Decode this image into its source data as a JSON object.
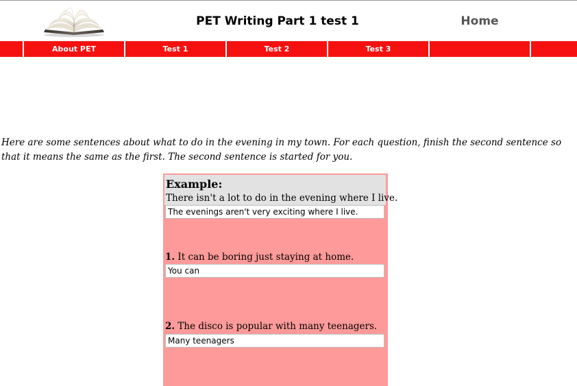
{
  "header": {
    "site_title": "PET Writing Part 1 test 1",
    "home_label": "Home"
  },
  "nav": {
    "items": [
      {
        "label": ""
      },
      {
        "label": "About PET"
      },
      {
        "label": "Test 1"
      },
      {
        "label": "Test 2"
      },
      {
        "label": "Test 3"
      },
      {
        "label": ""
      },
      {
        "label": ""
      }
    ]
  },
  "intro": "Here are some sentences about what to do in the evening in my town. For each question, finish the second sentence so that it means the same as the first. The second sentence is started for you.",
  "example": {
    "heading": "Example:",
    "sentence": "There isn't a lot to do in the evening where I live.",
    "answer": "The evenings aren't very exciting where I live."
  },
  "questions": [
    {
      "number": "1.",
      "text": "It can be boring just staying at home.",
      "answer": "You can"
    },
    {
      "number": "2.",
      "text": "The disco is popular with many teenagers.",
      "answer": "Many teenagers"
    }
  ],
  "colors": {
    "nav_red": "#f61111",
    "panel_pink": "#fe9a9a",
    "example_grey": "#e2e2e2",
    "home_grey": "#555555"
  },
  "icons": {
    "logo": "open-book-icon"
  }
}
